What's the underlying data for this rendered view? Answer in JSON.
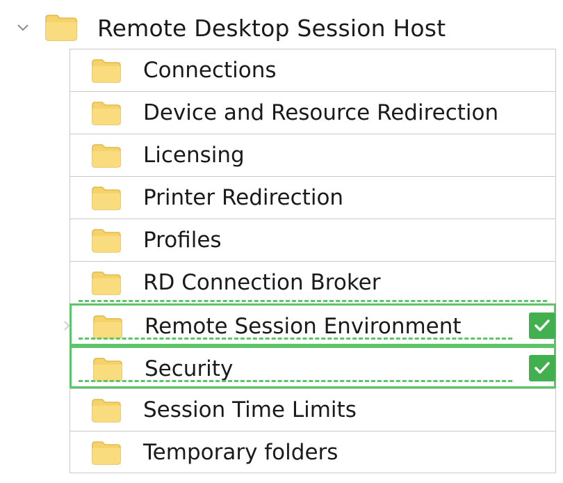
{
  "tree": {
    "parent": {
      "label": "Remote Desktop Session Host",
      "expanded": true,
      "icon": "folder-icon"
    },
    "children": [
      {
        "label": "Connections",
        "icon": "folder-icon",
        "selected": false
      },
      {
        "label": "Device and Resource Redirection",
        "icon": "folder-icon",
        "selected": false
      },
      {
        "label": "Licensing",
        "icon": "folder-icon",
        "selected": false
      },
      {
        "label": "Printer Redirection",
        "icon": "folder-icon",
        "selected": false
      },
      {
        "label": "Profiles",
        "icon": "folder-icon",
        "selected": false
      },
      {
        "label": "RD Connection Broker",
        "icon": "folder-icon",
        "selected": false
      },
      {
        "label": "Remote Session Environment",
        "icon": "folder-icon",
        "selected": true
      },
      {
        "label": "Security",
        "icon": "folder-icon",
        "selected": true
      },
      {
        "label": "Session Time Limits",
        "icon": "folder-icon",
        "selected": false
      },
      {
        "label": "Temporary folders",
        "icon": "folder-icon",
        "selected": false
      }
    ]
  },
  "colors": {
    "selection_border": "#5ec46a",
    "check_badge": "#43b04f",
    "folder_fill": "#f5d36a",
    "row_border": "#c9c9c9"
  }
}
